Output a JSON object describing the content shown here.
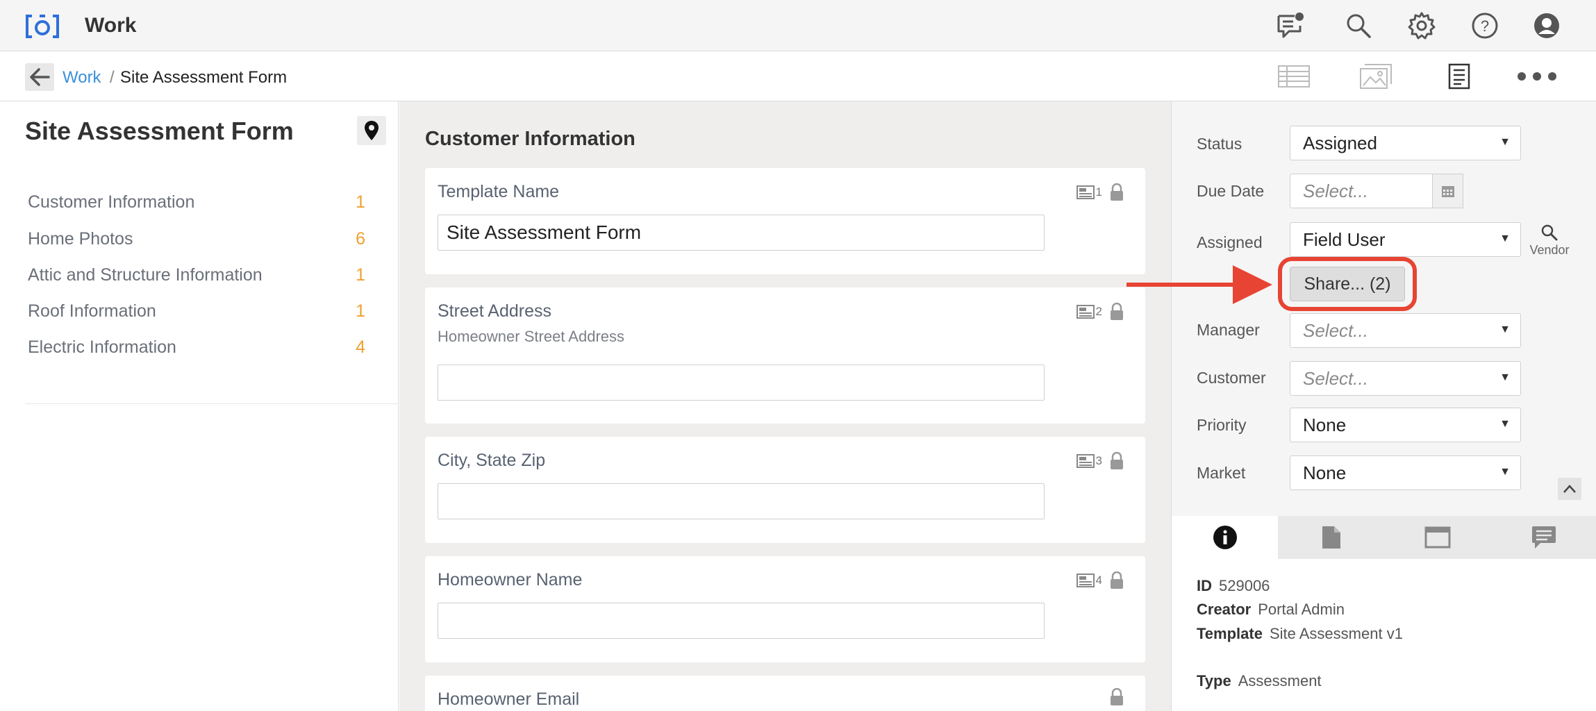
{
  "app": {
    "title": "Work"
  },
  "topbar": {
    "icons": [
      "chat-notification-icon",
      "search-icon",
      "gear-icon",
      "help-icon",
      "user-avatar-icon"
    ]
  },
  "breadcrumb": {
    "root": "Work",
    "separator": "/",
    "current": "Site Assessment Form"
  },
  "views": [
    "table-view-icon",
    "gallery-view-icon",
    "form-view-icon",
    "more-icon"
  ],
  "form": {
    "title": "Site Assessment Form",
    "sections": [
      {
        "label": "Customer Information",
        "count": "1"
      },
      {
        "label": "Home Photos",
        "count": "6"
      },
      {
        "label": "Attic and Structure Information",
        "count": "1"
      },
      {
        "label": "Roof Information",
        "count": "1"
      },
      {
        "label": "Electric Information",
        "count": "4"
      }
    ]
  },
  "main": {
    "section_title": "Customer Information",
    "fields": [
      {
        "label": "Template Name",
        "sub": "",
        "value": "Site Assessment Form",
        "meta": "1"
      },
      {
        "label": "Street Address",
        "sub": "Homeowner Street Address",
        "value": "",
        "meta": "2"
      },
      {
        "label": "City, State Zip",
        "sub": "",
        "value": "",
        "meta": "3"
      },
      {
        "label": "Homeowner Name",
        "sub": "",
        "value": "",
        "meta": "4"
      },
      {
        "label": "Homeowner Email",
        "sub": "",
        "value": "",
        "meta": ""
      }
    ]
  },
  "details": {
    "status": {
      "label": "Status",
      "value": "Assigned"
    },
    "due_date": {
      "label": "Due Date",
      "placeholder": "Select..."
    },
    "assigned": {
      "label": "Assigned",
      "value": "Field User"
    },
    "vendor_label": "Vendor",
    "share_label": "Share... (2)",
    "manager": {
      "label": "Manager",
      "placeholder": "Select..."
    },
    "customer": {
      "label": "Customer",
      "placeholder": "Select..."
    },
    "priority": {
      "label": "Priority",
      "value": "None"
    },
    "market": {
      "label": "Market",
      "value": "None"
    }
  },
  "tabs": [
    "info-icon",
    "document-icon",
    "window-icon",
    "comment-icon"
  ],
  "info": {
    "id_label": "ID",
    "id_value": "529006",
    "creator_label": "Creator",
    "creator_value": "Portal Admin",
    "template_label": "Template",
    "template_value": "Site Assessment v1",
    "type_label": "Type",
    "type_value": "Assessment"
  },
  "colors": {
    "accent": "#3b8fd8",
    "count": "#f0a030",
    "annotation": "#e74433"
  }
}
